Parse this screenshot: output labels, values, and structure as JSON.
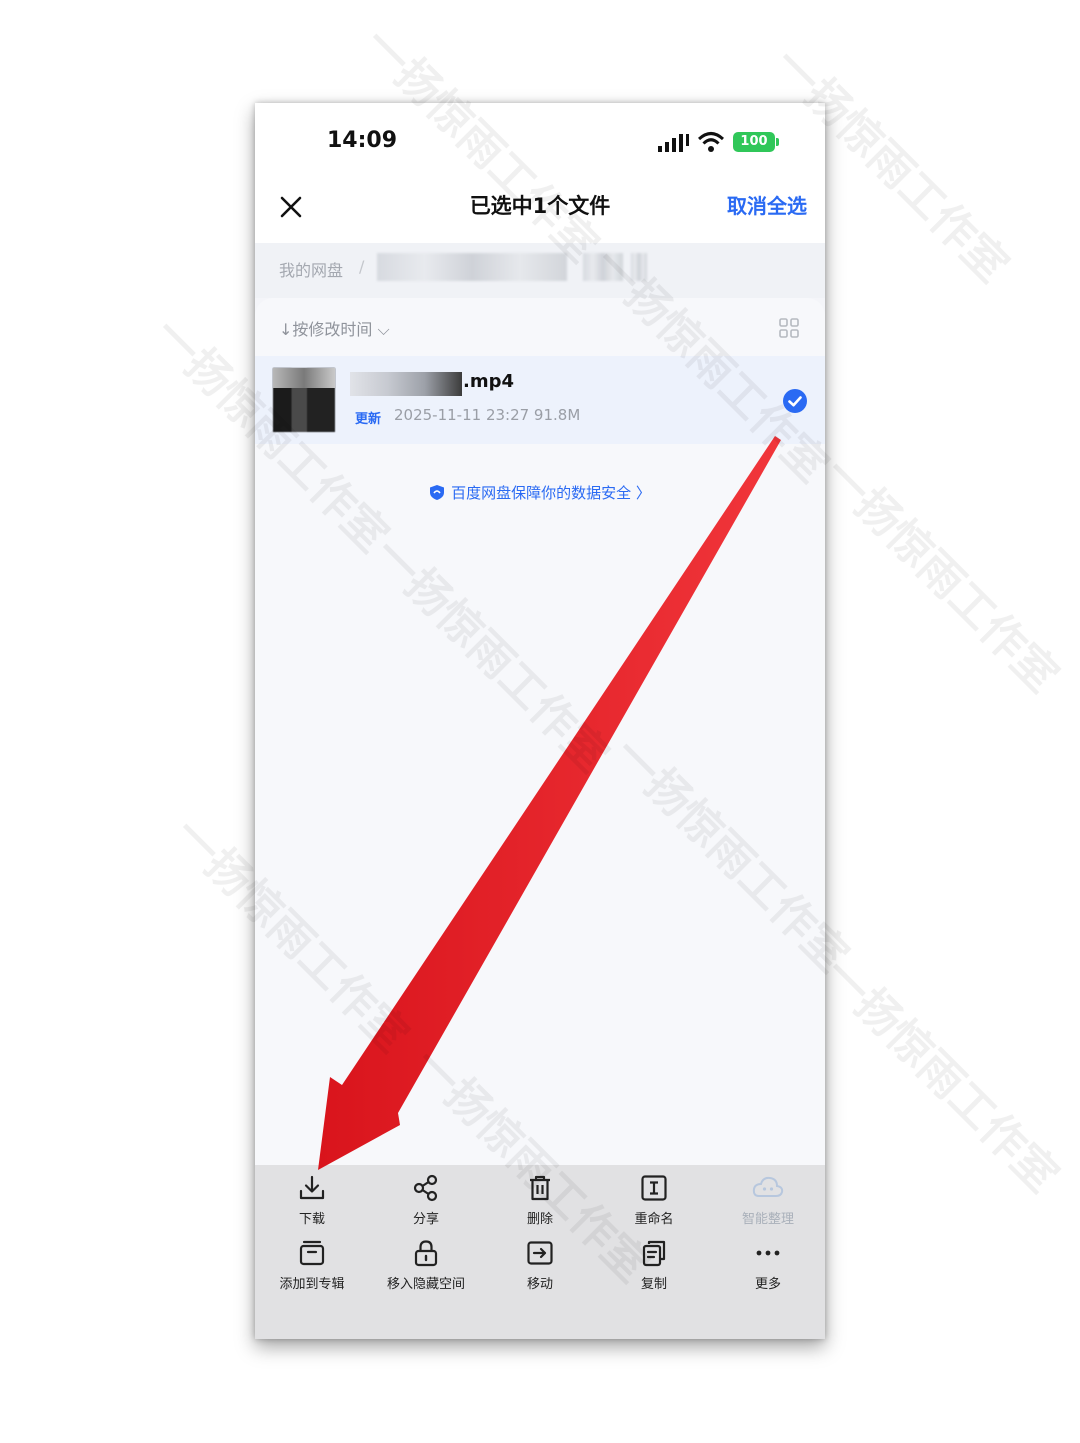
{
  "status_bar": {
    "time": "14:09",
    "battery": "100"
  },
  "header": {
    "title": "已选中1个文件",
    "select_all": "取消全选"
  },
  "breadcrumb": {
    "root": "我的网盘",
    "separator": "/"
  },
  "list": {
    "sort_label": "↓按修改时间 ⌵",
    "files": [
      {
        "name": ".mp4",
        "badge": "更新",
        "meta": "2025-11-11 23:27   91.8M",
        "selected": true
      }
    ],
    "security_link": "百度网盘保障你的数据安全 〉"
  },
  "actions": {
    "row1": [
      {
        "label": "下载",
        "icon": "download-icon"
      },
      {
        "label": "分享",
        "icon": "share-icon"
      },
      {
        "label": "删除",
        "icon": "trash-icon"
      },
      {
        "label": "重命名",
        "icon": "rename-icon"
      },
      {
        "label": "智能整理",
        "icon": "smart-organize-icon",
        "disabled": true
      }
    ],
    "row2": [
      {
        "label": "添加到专辑",
        "icon": "album-icon"
      },
      {
        "label": "移入隐藏空间",
        "icon": "lock-icon"
      },
      {
        "label": "移动",
        "icon": "move-icon"
      },
      {
        "label": "复制",
        "icon": "copy-icon"
      },
      {
        "label": "更多",
        "icon": "more-icon"
      }
    ]
  },
  "watermark_text": "一扬惊雨工作室",
  "colors": {
    "accent": "#2a6af3",
    "arrow": "#e8232a",
    "battery": "#30c759"
  }
}
